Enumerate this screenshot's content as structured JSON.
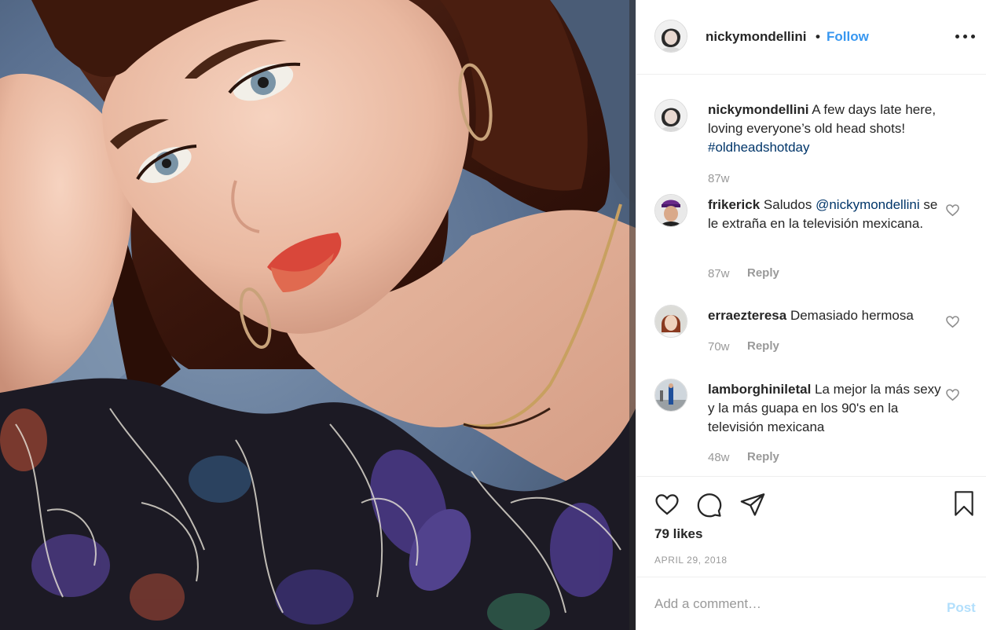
{
  "author": {
    "username": "nickymondellini",
    "follow_label": "Follow",
    "separator": "•"
  },
  "caption": {
    "username": "nickymondellini",
    "text": "A few days late here, loving everyone’s old head shots!",
    "hashtag": "#oldheadshotday",
    "age": "87w"
  },
  "comments": [
    {
      "username": "frikerick",
      "text_before": "Saludos",
      "mention": "@nickymondellini",
      "text_after": "se le extraña en la televisión mexicana.",
      "age": "87w",
      "reply_label": "Reply"
    },
    {
      "username": "erraezteresa",
      "text": "Demasiado hermosa",
      "age": "70w",
      "reply_label": "Reply"
    },
    {
      "username": "lamborghiniletal",
      "text": "La mejor la más sexy y la más guapa en los 90's en la televisión mexicana",
      "age": "48w",
      "reply_label": "Reply"
    }
  ],
  "engagement": {
    "likes": "79 likes",
    "date": "APRIL 29, 2018"
  },
  "add_comment": {
    "placeholder": "Add a comment…",
    "post_label": "Post"
  },
  "icons": {
    "like": "heart-icon",
    "comment": "speech-bubble-icon",
    "share": "paper-plane-icon",
    "save": "bookmark-icon",
    "more": "ellipsis-icon"
  },
  "colors": {
    "link_blue": "#3897f0",
    "hashtag_navy": "#003569",
    "muted_gray": "#999999",
    "post_disabled": "#b2dffc",
    "text": "#262626"
  }
}
